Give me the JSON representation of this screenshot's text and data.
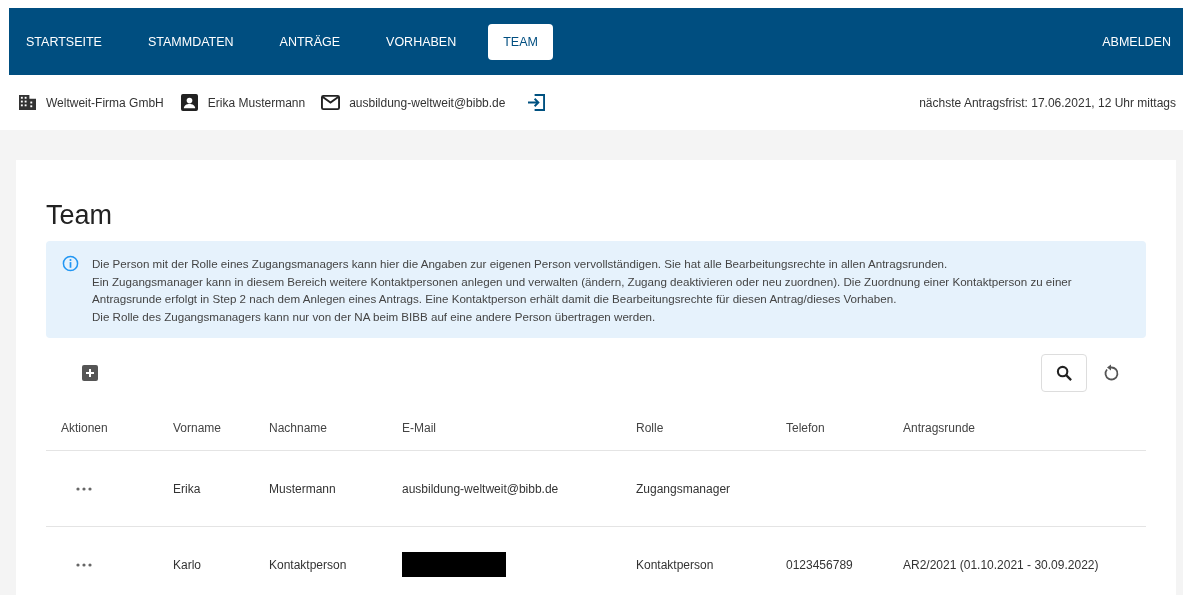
{
  "nav": {
    "items": [
      {
        "label": "STARTSEITE",
        "selected": false
      },
      {
        "label": "STAMMDATEN",
        "selected": false
      },
      {
        "label": "ANTRÄGE",
        "selected": false
      },
      {
        "label": "VORHABEN",
        "selected": false
      },
      {
        "label": "TEAM",
        "selected": true
      }
    ],
    "logout": "ABMELDEN"
  },
  "info_bar": {
    "items": [
      {
        "kind": "company",
        "text": "Weltweit-Firma GmbH"
      },
      {
        "kind": "person",
        "text": "Erika Mustermann"
      },
      {
        "kind": "email",
        "text": "ausbildung-weltweit@bibb.de"
      },
      {
        "kind": "login"
      }
    ],
    "deadline": "nächste Antragsfrist: 17.06.2021, 12 Uhr mittags"
  },
  "page": {
    "title": "Team",
    "notice": [
      "Die Person mit der Rolle eines Zugangsmanagers kann hier die Angaben zur eigenen Person vervollständigen. Sie hat alle Bearbeitungsrechte in allen Antragsrunden.",
      "Ein Zugangsmanager kann in diesem Bereich weitere Kontaktpersonen anlegen und verwalten (ändern, Zugang deaktivieren oder neu zuordnen). Die Zuordnung einer Kontaktperson zu einer Antragsrunde erfolgt in Step 2 nach dem Anlegen eines Antrags. Eine Kontaktperson erhält damit die Bearbeitungsrechte für diesen Antrag/dieses Vorhaben.",
      "Die Rolle des Zugangsmanagers kann nur von der NA beim BIBB auf eine andere Person übertragen werden."
    ]
  },
  "table": {
    "columns": [
      "Aktionen",
      "Vorname",
      "Nachname",
      "E-Mail",
      "Rolle",
      "Telefon",
      "Antragsrunde"
    ],
    "rows": [
      {
        "vorname": "Erika",
        "nachname": "Mustermann",
        "email": "ausbildung-weltweit@bibb.de",
        "email_redacted": false,
        "rolle": "Zugangsmanager",
        "telefon": "",
        "antragsrunde": ""
      },
      {
        "vorname": "Karlo",
        "nachname": "Kontaktperson",
        "email_redacted": true,
        "rolle": "Kontaktperson",
        "telefon": "0123456789",
        "antragsrunde": "AR2/2021 (01.10.2021 - 30.09.2022)"
      }
    ]
  }
}
